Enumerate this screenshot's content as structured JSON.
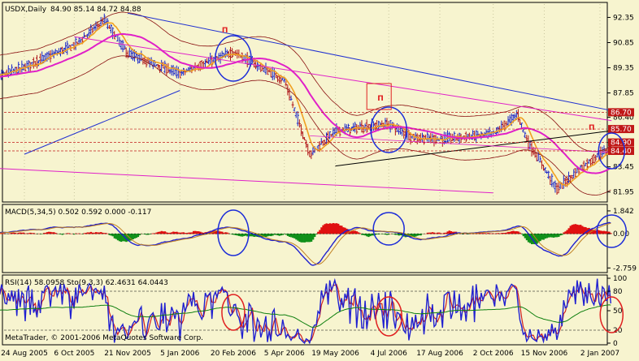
{
  "window": {
    "symbol_label": "USDX,Daily",
    "ohlc": "84.90 85.14 84.72 84.88",
    "copyright": "MetaTrader, © 2001-2006 MetaQuotes Software Corp."
  },
  "colors": {
    "background": "#f7f4cf",
    "bull_bar": "#1a26c8",
    "bear_bar": "#b0161a",
    "ma_fast": "#f0a020",
    "ma_slow": "#e020c8",
    "envelope": "#8a1010",
    "trendline": "#2030d0",
    "annotation_red": "#e02020",
    "annotation_blue": "#1c2cd8",
    "macd_pos": "#e01010",
    "macd_neg": "#10901a",
    "rsi_blue": "#2020d0",
    "stoch_green": "#108010",
    "level_label_bg": "#c01818"
  },
  "chart_data": [
    {
      "type": "line",
      "panel": "price",
      "title": "USDX,Daily",
      "x": [
        "24 Aug 2005",
        "6 Oct 2005",
        "21 Nov 2005",
        "5 Jan 2006",
        "20 Feb 2006",
        "5 Apr 2006",
        "19 May 2006",
        "4 Jul 2006",
        "17 Aug 2006",
        "2 Oct 2006",
        "15 Nov 2006",
        "2 Jan 2007"
      ],
      "yticks": [
        92.35,
        90.85,
        89.35,
        87.85,
        86.4,
        84.9,
        83.45,
        81.95
      ],
      "ylim": [
        81.5,
        93.0
      ],
      "series": [
        {
          "values": [
            88.5,
            89.4,
            90.7,
            92.2,
            90.2,
            89.0,
            90.3,
            88.6,
            84.2,
            85.6,
            86.0,
            85.2,
            85.1,
            85.4,
            86.6,
            84.9,
            83.4,
            82.1,
            83.2,
            84.2,
            84.6
          ]
        }
      ],
      "series_dates": [
        "18 Jul 2005",
        "24 Aug 2005",
        "6 Oct 2005",
        "1 Nov 2005",
        "21 Nov 2005",
        "5 Jan 2006",
        "20 Feb 2006",
        "5 Apr 2006",
        "27 Apr 2006",
        "19 May 2006",
        "4 Jul 2006",
        "25 Jul 2006",
        "17 Aug 2006",
        "2 Oct 2006",
        "23 Oct 2006",
        "1 Nov 2006",
        "15 Nov 2006",
        "26 Nov 2006",
        "13 Dec 2006",
        "2 Jan 2007",
        "12 Jan 2007"
      ],
      "level_labels": [
        "86.70",
        "85.70",
        "84.90",
        "84.40"
      ]
    },
    {
      "type": "bar",
      "panel": "macd",
      "title": "MACD(5,34,5) 0.502 0.592 0.000 -0.117",
      "yticks": [
        1.842,
        0.0,
        -2.759
      ],
      "ylim": [
        -3.0,
        2.1
      ]
    },
    {
      "type": "line",
      "panel": "oscillators",
      "title": "RSI(14) 58.0958  Sto(9,3,3) 62.4631 64.0443",
      "yticks": [
        100,
        80,
        50,
        20,
        0
      ],
      "ylim": [
        0,
        100
      ]
    }
  ],
  "annotations": {
    "pulse_marks": [
      "Π",
      "Π",
      "Π"
    ]
  }
}
